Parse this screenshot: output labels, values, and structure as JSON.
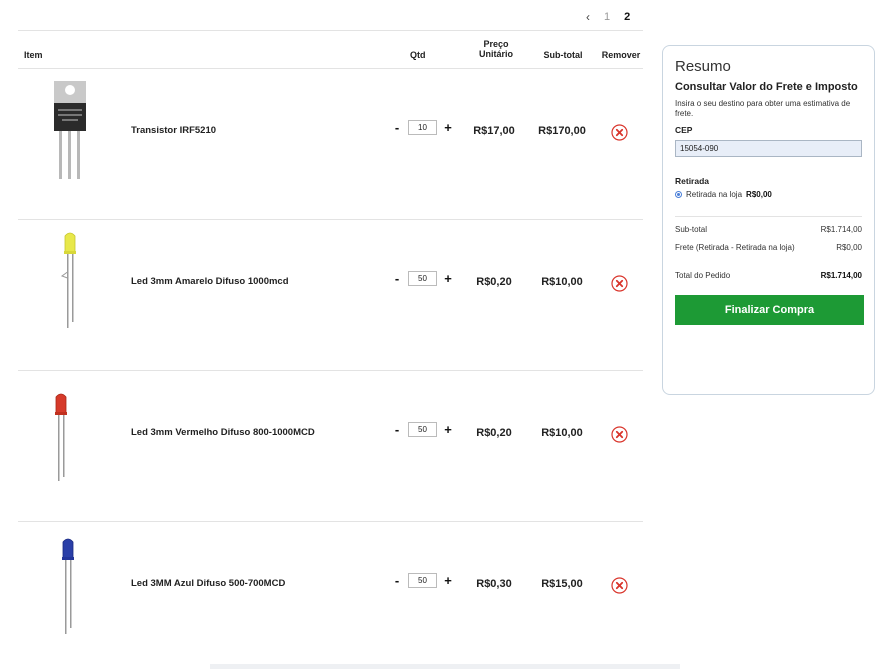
{
  "pagination": {
    "prev_icon": "chevron-left-icon",
    "pages": [
      "1",
      "2"
    ],
    "current": "2"
  },
  "table": {
    "headers": {
      "item": "Item",
      "qtd": "Qtd",
      "preco": "Preço Unitário",
      "subtotal": "Sub-total",
      "remover": "Remover"
    },
    "rows": [
      {
        "name": "Transistor IRF5210",
        "qty": "10",
        "unit_price": "R$17,00",
        "subtotal": "R$170,00",
        "thumb_icon": "transistor-image"
      },
      {
        "name": "Led 3mm Amarelo Difuso 1000mcd",
        "qty": "50",
        "unit_price": "R$0,20",
        "subtotal": "R$10,00",
        "thumb_icon": "led-yellow-image",
        "led_color": "#e8e84a"
      },
      {
        "name": "Led 3mm Vermelho Difuso 800-1000MCD",
        "qty": "50",
        "unit_price": "R$0,20",
        "subtotal": "R$10,00",
        "thumb_icon": "led-red-image",
        "led_color": "#d63a2a"
      },
      {
        "name": "Led 3MM Azul Difuso 500-700MCD",
        "qty": "50",
        "unit_price": "R$0,30",
        "subtotal": "R$15,00",
        "thumb_icon": "led-blue-image",
        "led_color": "#2a3fa8"
      }
    ],
    "minus_label": "-",
    "plus_label": "+",
    "remove_icon": "remove-x-icon"
  },
  "summary": {
    "title": "Resumo",
    "shipping_title": "Consultar Valor do Frete e Imposto",
    "shipping_desc": "Insira o seu destino para obter uma estimativa de frete.",
    "cep_label": "CEP",
    "cep_value": "15054-090",
    "pickup_title": "Retirada",
    "pickup_option": "Retirada na loja",
    "pickup_price": "R$0,00",
    "subtotal_label": "Sub-total",
    "subtotal_value": "R$1.714,00",
    "freight_label": "Frete (Retirada - Retirada na loja)",
    "freight_value": "R$0,00",
    "total_label": "Total do Pedido",
    "total_value": "R$1.714,00",
    "checkout_label": "Finalizar Compra"
  },
  "colors": {
    "checkout_green": "#1d9a35",
    "remove_red": "#d9342b",
    "radio_blue": "#4a7fd8",
    "input_bg": "#e8eef8"
  }
}
